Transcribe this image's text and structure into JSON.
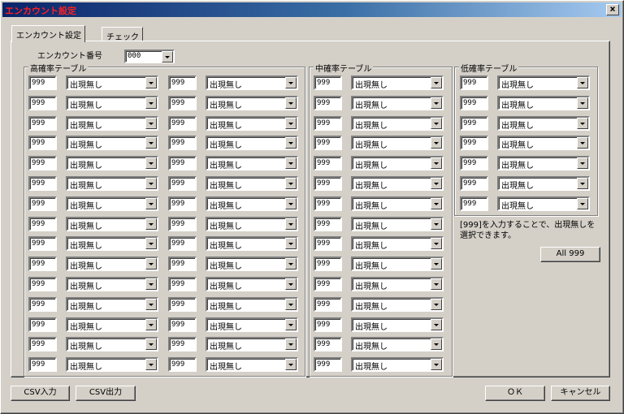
{
  "window": {
    "title": "エンカウント設定"
  },
  "tabs": [
    {
      "label": "エンカウント設定",
      "active": true
    },
    {
      "label": "チェック",
      "active": false
    }
  ],
  "encounter": {
    "label": "エンカウント番号",
    "value": "000"
  },
  "groups": {
    "high": {
      "title": "高確率テーブル"
    },
    "mid": {
      "title": "中確率テーブル"
    },
    "low": {
      "title": "低確率テーブル"
    }
  },
  "entry": {
    "value": "999",
    "selection": "出現無し"
  },
  "hint": "[999]を入力することで、出現無しを選択できます。",
  "buttons": {
    "all999": "All 999",
    "csv_in": "CSV入力",
    "csv_out": "CSV出力",
    "ok": "ＯＫ",
    "cancel": "キャンセル"
  },
  "colors": {
    "title_text": "#ff2020",
    "title_bar_start": "#0a246a",
    "face": "#d4d0c8"
  }
}
